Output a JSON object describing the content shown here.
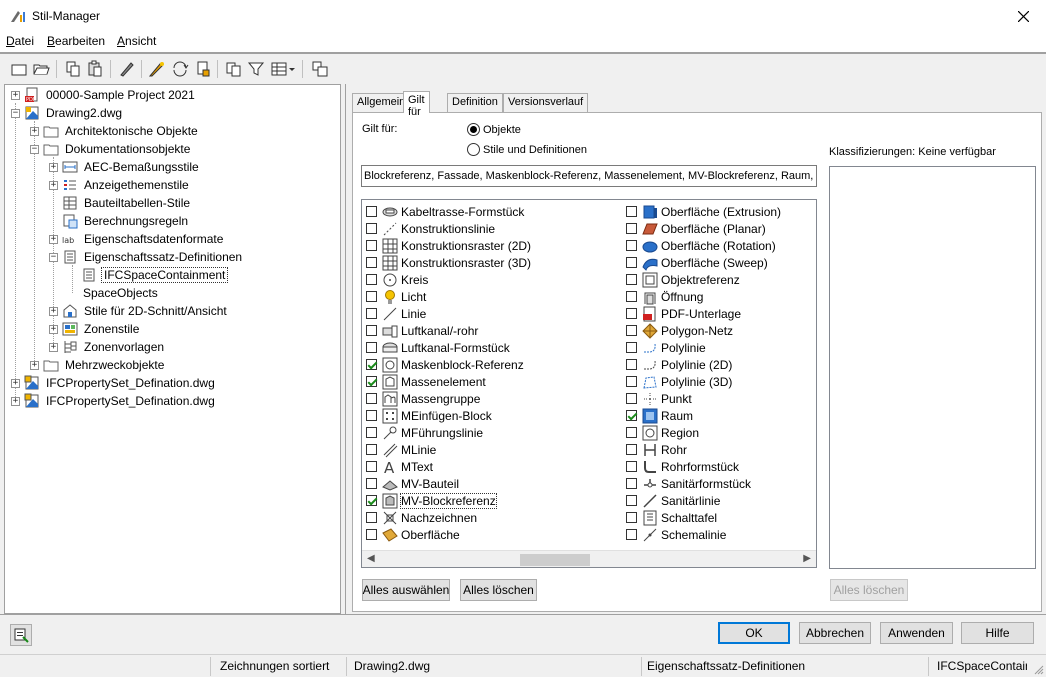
{
  "window": {
    "title": "Stil-Manager"
  },
  "menu": [
    {
      "label": "Datei",
      "accel": "D",
      "rest": "atei"
    },
    {
      "label": "Bearbeiten",
      "accel": "B",
      "rest": "earbeiten"
    },
    {
      "label": "Ansicht",
      "accel": "A",
      "rest": "nsicht"
    }
  ],
  "tree": [
    {
      "label": "00000-Sample Project 2021",
      "level": 0,
      "expander": "+",
      "icon": "project-icon"
    },
    {
      "label": "Drawing2.dwg",
      "level": 0,
      "expander": "−",
      "icon": "drawing-icon"
    },
    {
      "label": "Architektonische Objekte",
      "level": 1,
      "expander": "+",
      "icon": "folder-icon"
    },
    {
      "label": "Dokumentationsobjekte",
      "level": 1,
      "expander": "−",
      "icon": "folder-icon"
    },
    {
      "label": "AEC-Bemaßungsstile",
      "level": 2,
      "expander": "+",
      "icon": "dimension-style-icon"
    },
    {
      "label": "Anzeigethemenstile",
      "level": 2,
      "expander": "+",
      "icon": "display-theme-icon"
    },
    {
      "label": "Bauteiltabellen-Stile",
      "level": 2,
      "expander": "",
      "icon": "schedule-table-icon"
    },
    {
      "label": "Berechnungsregeln",
      "level": 2,
      "expander": "",
      "icon": "calculation-rules-icon"
    },
    {
      "label": "Eigenschaftsdatenformate",
      "level": 2,
      "expander": "+",
      "icon": "property-format-icon"
    },
    {
      "label": "Eigenschaftssatz-Definitionen",
      "level": 2,
      "expander": "−",
      "icon": "property-set-icon"
    },
    {
      "label": "IFCSpaceContainment",
      "level": 3,
      "expander": "",
      "icon": "property-set-item-icon",
      "selected": true
    },
    {
      "label": "SpaceObjects",
      "level": 3,
      "expander": "",
      "icon": ""
    },
    {
      "label": "Stile für 2D-Schnitt/Ansicht",
      "level": 2,
      "expander": "+",
      "icon": "section-style-icon"
    },
    {
      "label": "Zonenstile",
      "level": 2,
      "expander": "+",
      "icon": "zone-style-icon"
    },
    {
      "label": "Zonenvorlagen",
      "level": 2,
      "expander": "+",
      "icon": "zone-template-icon"
    },
    {
      "label": "Mehrzweckobjekte",
      "level": 1,
      "expander": "+",
      "icon": "folder-icon"
    },
    {
      "label": "IFCPropertySet_Defination.dwg",
      "level": 0,
      "expander": "+",
      "icon": "drawing-lock-icon"
    },
    {
      "label": "IFCPropertySet_Defination.dwg",
      "level": 0,
      "expander": "+",
      "icon": "drawing-lock-icon"
    }
  ],
  "tabs": [
    {
      "label": "Allgemein",
      "active": false
    },
    {
      "label": "Gilt für",
      "active": true
    },
    {
      "label": "Definition",
      "active": false
    },
    {
      "label": "Versionsverlauf",
      "active": false
    }
  ],
  "applies": {
    "label": "Gilt für:",
    "options": [
      {
        "label": "Objekte",
        "selected": true
      },
      {
        "label": "Stile und Definitionen",
        "selected": false
      }
    ],
    "summary": "Blockreferenz, Fassade, Maskenblock-Referenz, Massenelement, MV-Blockreferenz, Raum, ..."
  },
  "objects_left": [
    {
      "label": "Kabeltrasse-Formstück",
      "checked": false,
      "icon": "cable-tray-fitting-icon"
    },
    {
      "label": "Konstruktionslinie",
      "checked": false,
      "icon": "construction-line-icon"
    },
    {
      "label": "Konstruktionsraster (2D)",
      "checked": false,
      "icon": "grid-2d-icon"
    },
    {
      "label": "Konstruktionsraster (3D)",
      "checked": false,
      "icon": "grid-3d-icon"
    },
    {
      "label": "Kreis",
      "checked": false,
      "icon": "circle-icon"
    },
    {
      "label": "Licht",
      "checked": false,
      "icon": "light-icon"
    },
    {
      "label": "Linie",
      "checked": false,
      "icon": "line-icon"
    },
    {
      "label": "Luftkanal/-rohr",
      "checked": false,
      "icon": "duct-icon"
    },
    {
      "label": "Luftkanal-Formstück",
      "checked": false,
      "icon": "duct-fitting-icon"
    },
    {
      "label": "Maskenblock-Referenz",
      "checked": true,
      "icon": "mask-block-icon"
    },
    {
      "label": "Massenelement",
      "checked": true,
      "icon": "mass-element-icon"
    },
    {
      "label": "Massengruppe",
      "checked": false,
      "icon": "mass-group-icon"
    },
    {
      "label": "MEinfügen-Block",
      "checked": false,
      "icon": "minsert-block-icon"
    },
    {
      "label": "MFührungslinie",
      "checked": false,
      "icon": "mleader-icon"
    },
    {
      "label": "MLinie",
      "checked": false,
      "icon": "mline-icon"
    },
    {
      "label": "MText",
      "checked": false,
      "icon": "mtext-icon"
    },
    {
      "label": "MV-Bauteil",
      "checked": false,
      "icon": "mv-part-icon"
    },
    {
      "label": "MV-Blockreferenz",
      "checked": true,
      "icon": "mv-block-icon",
      "focused": true
    },
    {
      "label": "Nachzeichnen",
      "checked": false,
      "icon": "trace-icon"
    },
    {
      "label": "Oberfläche",
      "checked": false,
      "icon": "surface-icon"
    }
  ],
  "objects_right": [
    {
      "label": "Oberfläche (Extrusion)",
      "checked": false,
      "icon": "surface-extrusion-icon"
    },
    {
      "label": "Oberfläche (Planar)",
      "checked": false,
      "icon": "surface-planar-icon"
    },
    {
      "label": "Oberfläche (Rotation)",
      "checked": false,
      "icon": "surface-revolve-icon"
    },
    {
      "label": "Oberfläche (Sweep)",
      "checked": false,
      "icon": "surface-sweep-icon"
    },
    {
      "label": "Objektreferenz",
      "checked": false,
      "icon": "object-reference-icon"
    },
    {
      "label": "Öffnung",
      "checked": false,
      "icon": "opening-icon"
    },
    {
      "label": "PDF-Unterlage",
      "checked": false,
      "icon": "pdf-underlay-icon"
    },
    {
      "label": "Polygon-Netz",
      "checked": false,
      "icon": "polygon-mesh-icon"
    },
    {
      "label": "Polylinie",
      "checked": false,
      "icon": "polyline-icon"
    },
    {
      "label": "Polylinie (2D)",
      "checked": false,
      "icon": "polyline-2d-icon"
    },
    {
      "label": "Polylinie (3D)",
      "checked": false,
      "icon": "polyline-3d-icon"
    },
    {
      "label": "Punkt",
      "checked": false,
      "icon": "point-icon"
    },
    {
      "label": "Raum",
      "checked": true,
      "icon": "space-icon"
    },
    {
      "label": "Region",
      "checked": false,
      "icon": "region-icon"
    },
    {
      "label": "Rohr",
      "checked": false,
      "icon": "pipe-icon"
    },
    {
      "label": "Rohrformstück",
      "checked": false,
      "icon": "pipe-fitting-icon"
    },
    {
      "label": "Sanitärformstück",
      "checked": false,
      "icon": "plumbing-fitting-icon"
    },
    {
      "label": "Sanitärlinie",
      "checked": false,
      "icon": "plumbing-line-icon"
    },
    {
      "label": "Schalttafel",
      "checked": false,
      "icon": "panel-icon"
    },
    {
      "label": "Schemalinie",
      "checked": false,
      "icon": "schematic-line-icon"
    }
  ],
  "klass": {
    "label": "Klassifizierungen: Keine verfügbar",
    "clear": "Alles löschen"
  },
  "buttons": {
    "select_all": "Alles auswählen",
    "clear_all": "Alles löschen",
    "ok": "OK",
    "cancel": "Abbrechen",
    "apply": "Anwenden",
    "help": "Hilfe"
  },
  "status": [
    "Zeichnungen sortiert",
    "Drawing2.dwg",
    "Eigenschaftssatz-Definitionen",
    "IFCSpaceContainment"
  ],
  "colors": {
    "accent": "#0078d7",
    "check": "#1a8a1a"
  }
}
